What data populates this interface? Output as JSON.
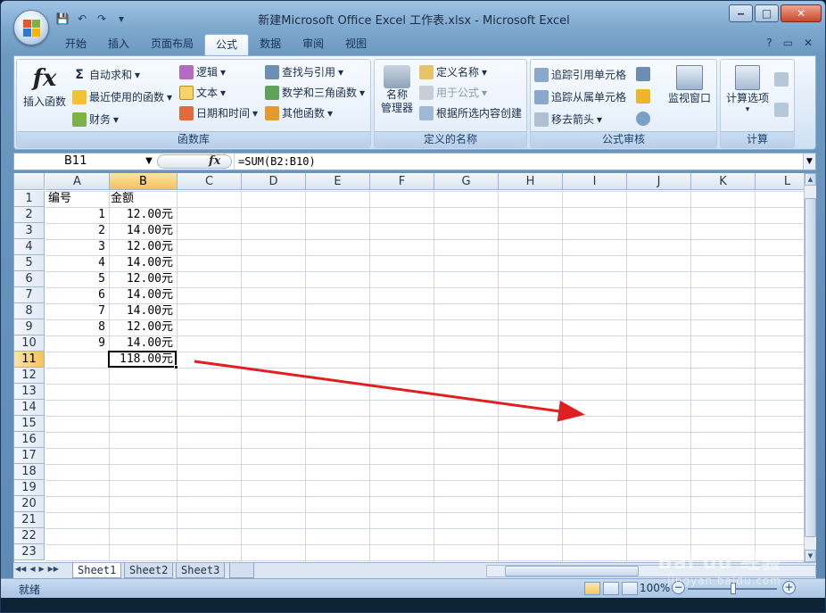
{
  "window": {
    "title": "新建Microsoft Office Excel 工作表.xlsx - Microsoft Excel",
    "controls": {
      "minimize": "‒",
      "maximize": "□",
      "close": "✕"
    }
  },
  "qat": {
    "save": "💾",
    "undo": "↶",
    "redo": "↷",
    "more": "▾"
  },
  "ribbon": {
    "tabs": [
      "开始",
      "插入",
      "页面布局",
      "公式",
      "数据",
      "审阅",
      "视图"
    ],
    "active_tab": "公式",
    "right_icons": {
      "help": "?",
      "restore": "▭",
      "close": "✕"
    },
    "groups": {
      "function_library": {
        "label": "函数库",
        "insert_function": "插入函数",
        "autosum": "自动求和",
        "recently_used": "最近使用的函数",
        "financial": "财务",
        "logical": "逻辑",
        "text": "文本",
        "date_time": "日期和时间",
        "lookup": "查找与引用",
        "math_trig": "数学和三角函数",
        "more_functions": "其他函数"
      },
      "defined_names": {
        "label": "定义的名称",
        "name_manager": "名称\n管理器",
        "define_name": "定义名称",
        "use_in_formula": "用于公式",
        "create_from_selection": "根据所选内容创建"
      },
      "formula_auditing": {
        "label": "公式审核",
        "trace_precedents": "追踪引用单元格",
        "trace_dependents": "追踪从属单元格",
        "remove_arrows": "移去箭头",
        "watch_window": "监视窗口"
      },
      "calculation": {
        "label": "计算",
        "calc_options": "计算选项"
      }
    }
  },
  "formula_bar": {
    "name_box": "B11",
    "fx": "fx",
    "formula": "=SUM(B2:B10)"
  },
  "sheet": {
    "columns": [
      "A",
      "B",
      "C",
      "D",
      "E",
      "F",
      "G",
      "H",
      "I",
      "J",
      "K",
      "L"
    ],
    "rows": [
      "1",
      "2",
      "3",
      "4",
      "5",
      "6",
      "7",
      "8",
      "9",
      "10",
      "11",
      "12",
      "13",
      "14",
      "15",
      "16",
      "17",
      "18",
      "19",
      "20",
      "21",
      "22",
      "23"
    ],
    "selected_column": "B",
    "selected_row": "11",
    "header": {
      "a1": "编号",
      "b1": "金额"
    },
    "data": [
      {
        "a": "1",
        "b": "12.00元"
      },
      {
        "a": "2",
        "b": "14.00元"
      },
      {
        "a": "3",
        "b": "12.00元"
      },
      {
        "a": "4",
        "b": "14.00元"
      },
      {
        "a": "5",
        "b": "12.00元"
      },
      {
        "a": "6",
        "b": "14.00元"
      },
      {
        "a": "7",
        "b": "14.00元"
      },
      {
        "a": "8",
        "b": "12.00元"
      },
      {
        "a": "9",
        "b": "14.00元"
      }
    ],
    "total": "118.00元",
    "tabs": [
      "Sheet1",
      "Sheet2",
      "Sheet3"
    ],
    "active_tab": "Sheet1"
  },
  "status": {
    "mode": "就绪",
    "zoom": "100%"
  },
  "annotation": {
    "arrow_color": "#e02020"
  },
  "watermark": {
    "brand": "Bai du 经验",
    "url": "jingyan.baidu.com"
  }
}
